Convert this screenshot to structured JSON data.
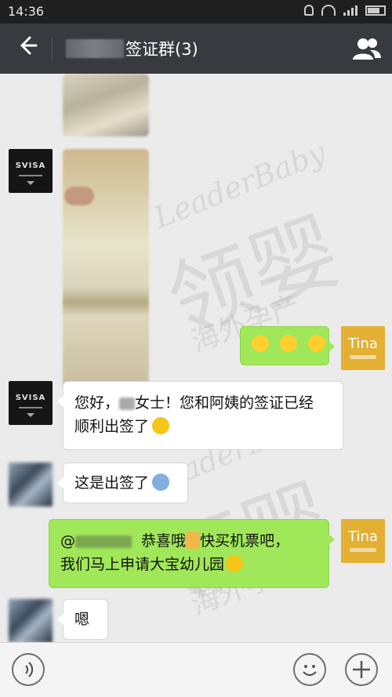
{
  "status_bar": {
    "time": "14:36",
    "icons": [
      "bell-icon",
      "wifi-icon",
      "signal-icon",
      "battery-icon"
    ]
  },
  "title_bar": {
    "title": "签证群(3)",
    "back_icon": "back-arrow-icon",
    "members_icon": "group-members-icon"
  },
  "watermark": {
    "brand_en": "LeaderBaby",
    "brand_cn": "领婴",
    "sub_cn": "海外孕产"
  },
  "avatars": {
    "svisa_label": "SVISA",
    "tina_label": "Tina"
  },
  "messages": [
    {
      "sender": "svisa",
      "type": "image"
    },
    {
      "sender": "svisa",
      "type": "image"
    },
    {
      "sender": "tina",
      "type": "emoji",
      "emojis": [
        "grinning-sweat-emoji",
        "grinning-sweat-emoji",
        "grinning-sweat-emoji"
      ]
    },
    {
      "sender": "svisa",
      "type": "text",
      "line1_prefix": "您好，",
      "line1_suffix": "女士！您和阿姨的签证已经",
      "line2": "顺利出签了"
    },
    {
      "sender": "member",
      "type": "text",
      "text": "这是出签了"
    },
    {
      "sender": "tina",
      "type": "text",
      "line1_prefix": "@",
      "line1_middle": "恭喜哦",
      "line1_suffix": "快买机票吧，",
      "line2": "我们马上申请大宝幼儿园"
    },
    {
      "sender": "member",
      "type": "text",
      "text": "嗯"
    }
  ],
  "input_bar": {
    "voice_icon": "voice-icon",
    "emoji_icon": "emoji-icon",
    "add_icon": "plus-icon"
  },
  "colors": {
    "titlebar": "#393a3f",
    "status_bar": "#1f1f1f",
    "chat_bg": "#ebebeb",
    "green_bubble": "#a0e759",
    "tina_avatar": "#e3b033"
  }
}
